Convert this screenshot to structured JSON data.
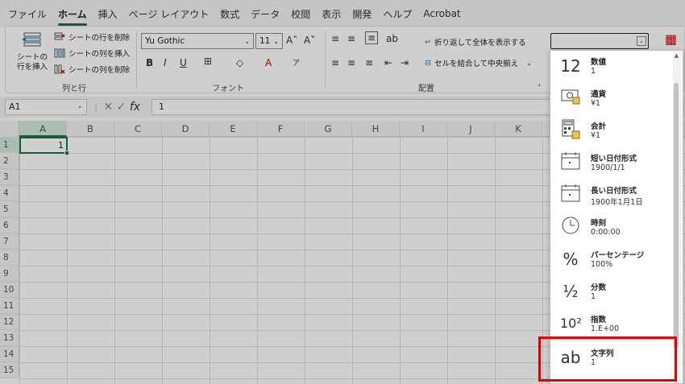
{
  "menu": {
    "items": [
      "ファイル",
      "ホーム",
      "挿入",
      "ページ レイアウト",
      "数式",
      "データ",
      "校閲",
      "表示",
      "開発",
      "ヘルプ",
      "Acrobat"
    ],
    "active_index": 1
  },
  "ribbon": {
    "insert_sheet_label": "シートの行を挿入",
    "delete_row": "シートの行を削除",
    "insert_col": "シートの列を挿入",
    "delete_col": "シートの列を削除",
    "group_rows_cols": "列と行",
    "font_name": "Yu Gothic",
    "font_size": "11",
    "group_font": "フォント",
    "wrap_text": "折り返して全体を表示する",
    "merge_center": "セルを結合して中央揃え",
    "group_alignment": "配置",
    "number_format_value": ""
  },
  "formula_bar": {
    "name_box": "A1",
    "formula": "1"
  },
  "grid": {
    "columns": [
      "A",
      "B",
      "C",
      "D",
      "E",
      "F",
      "G",
      "H",
      "I",
      "J",
      "K"
    ],
    "rows": [
      "1",
      "2",
      "3",
      "4",
      "5",
      "6",
      "7",
      "8",
      "9",
      "10",
      "11",
      "12",
      "13",
      "14",
      "15"
    ],
    "cell_a1": "1"
  },
  "number_formats": [
    {
      "icon": "12",
      "name": "数値",
      "sample": "1"
    },
    {
      "icon": "currency-icon",
      "name": "通貨",
      "sample": "¥1"
    },
    {
      "icon": "accounting-icon",
      "name": "会計",
      "sample": " ¥1"
    },
    {
      "icon": "calendar-icon",
      "name": "短い日付形式",
      "sample": "1900/1/1"
    },
    {
      "icon": "calendar-icon",
      "name": "長い日付形式",
      "sample": "1900年1月1日"
    },
    {
      "icon": "clock-icon",
      "name": "時刻",
      "sample": "0:00:00"
    },
    {
      "icon": "%",
      "name": "パーセンテージ",
      "sample": "100%"
    },
    {
      "icon": "½",
      "name": "分数",
      "sample": "1"
    },
    {
      "icon": "10²",
      "name": "指数",
      "sample": "1.E+00"
    },
    {
      "icon": "ab",
      "name": "文字列",
      "sample": "1"
    }
  ],
  "highlight_color": "#e00000",
  "accent_color": "#1e7145"
}
